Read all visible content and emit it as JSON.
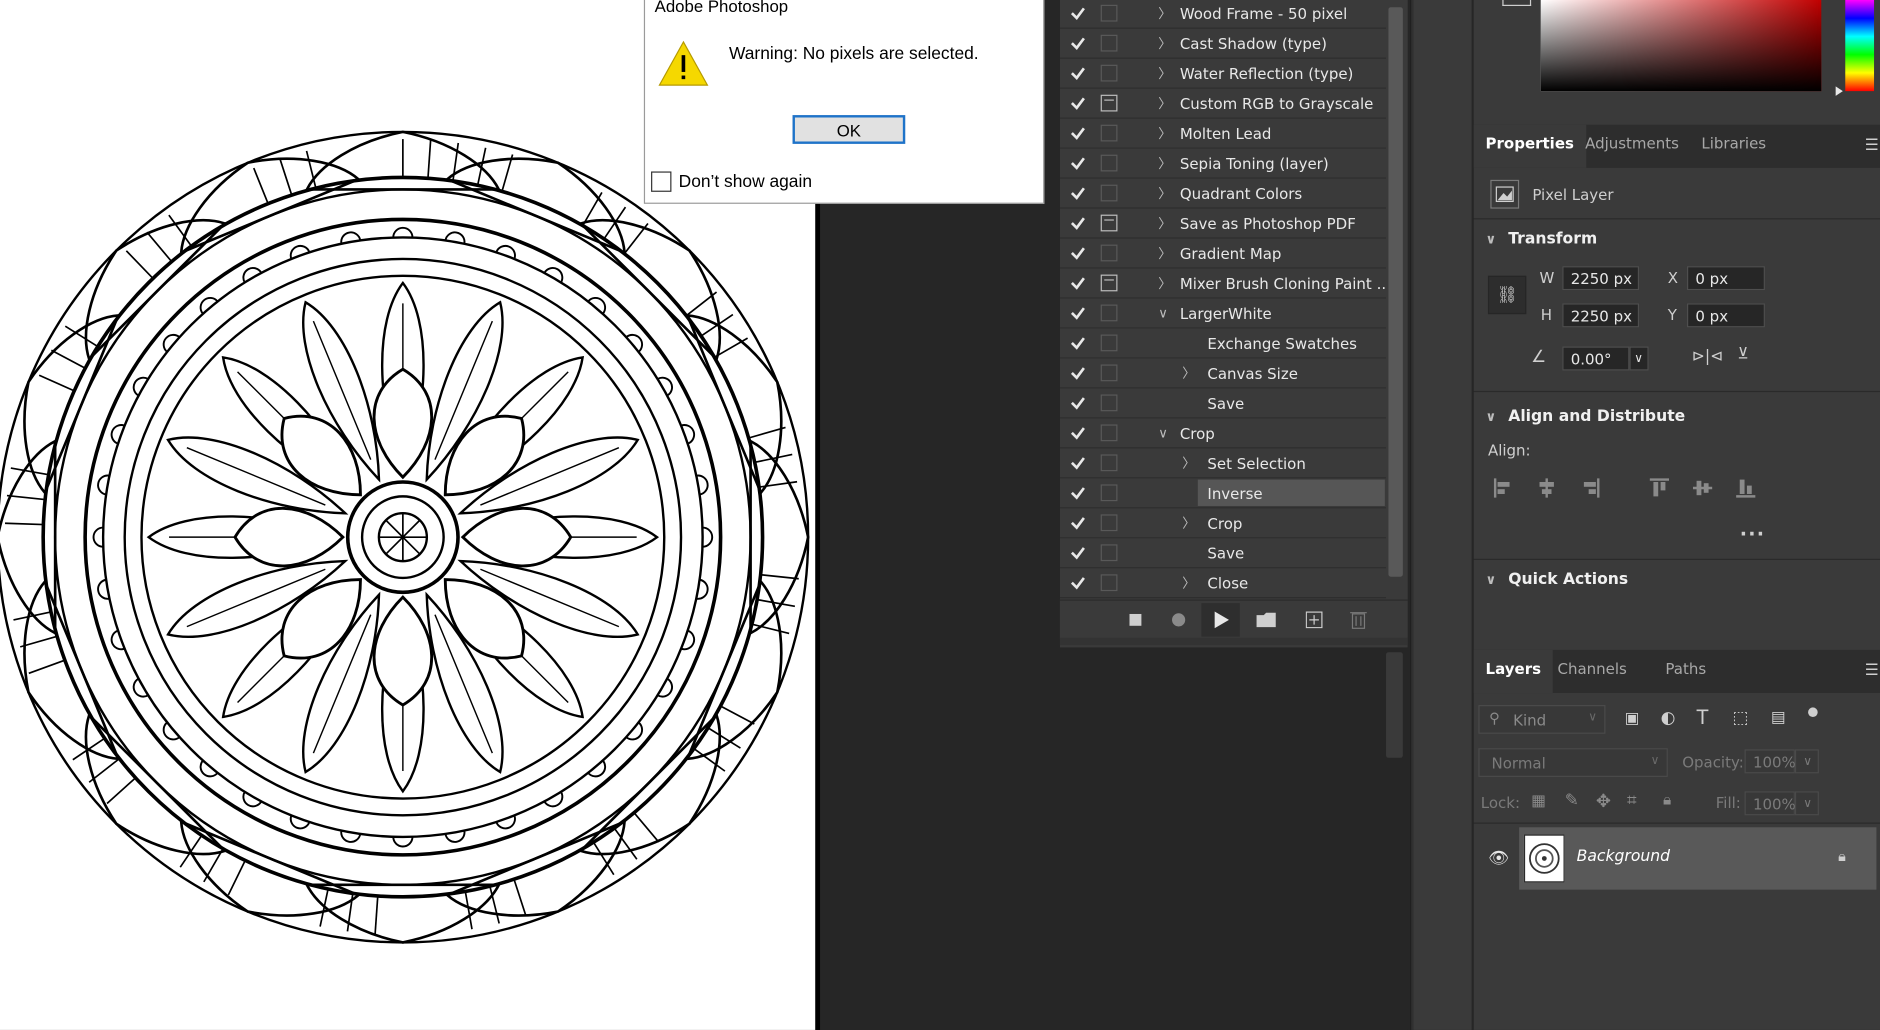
{
  "dialog": {
    "title": "Adobe Photoshop",
    "message": "Warning: No pixels are selected.",
    "ok_label": "OK",
    "dont_show_label": "Don’t show again"
  },
  "actions": {
    "rows": [
      {
        "label": "Wood Frame - 50 pixel",
        "dialog": false,
        "caret": true
      },
      {
        "label": "Cast Shadow (type)",
        "dialog": false,
        "caret": true
      },
      {
        "label": "Water Reflection (type)",
        "dialog": false,
        "caret": true
      },
      {
        "label": "Custom RGB to Grayscale",
        "dialog": true,
        "caret": true
      },
      {
        "label": "Molten Lead",
        "dialog": false,
        "caret": true
      },
      {
        "label": "Sepia Toning (layer)",
        "dialog": false,
        "caret": true
      },
      {
        "label": "Quadrant Colors",
        "dialog": false,
        "caret": true
      },
      {
        "label": "Save as Photoshop PDF",
        "dialog": true,
        "caret": true
      },
      {
        "label": "Gradient Map",
        "dialog": false,
        "caret": true
      },
      {
        "label": "Mixer Brush Cloning Paint ...",
        "dialog": true,
        "caret": true
      },
      {
        "label": "LargerWhite",
        "dialog": false,
        "caret": true
      },
      {
        "label": "Exchange Swatches",
        "dialog": false,
        "caret": false
      },
      {
        "label": "Canvas Size",
        "dialog": false,
        "caret": true
      },
      {
        "label": "Save",
        "dialog": false,
        "caret": false
      },
      {
        "label": "Crop",
        "dialog": false,
        "caret": true
      },
      {
        "label": "Set Selection",
        "dialog": false,
        "caret": true
      },
      {
        "label": "Inverse",
        "dialog": false,
        "caret": false
      },
      {
        "label": "Crop",
        "dialog": false,
        "caret": true
      },
      {
        "label": "Save",
        "dialog": false,
        "caret": false
      },
      {
        "label": "Close",
        "dialog": false,
        "caret": true
      }
    ]
  },
  "right": {
    "tabs": [
      "Properties",
      "Adjustments",
      "Libraries"
    ],
    "layer_kind": "Pixel Layer",
    "transform": {
      "title": "Transform",
      "w_label": "W",
      "w_value": "2250 px",
      "h_label": "H",
      "h_value": "2250 px",
      "x_label": "X",
      "x_value": "0 px",
      "y_label": "Y",
      "y_value": "0 px",
      "angle_value": "0.00°"
    },
    "align": {
      "title": "Align and Distribute",
      "label": "Align:"
    },
    "quick_actions": "Quick Actions",
    "layers_tabs": [
      "Layers",
      "Channels",
      "Paths"
    ],
    "filter_placeholder": "Kind",
    "blend_mode": "Normal",
    "opacity_label": "Opacity:",
    "opacity_value": "100%",
    "lock_label": "Lock:",
    "fill_label": "Fill:",
    "fill_value": "100%",
    "layer_name": "Background"
  }
}
